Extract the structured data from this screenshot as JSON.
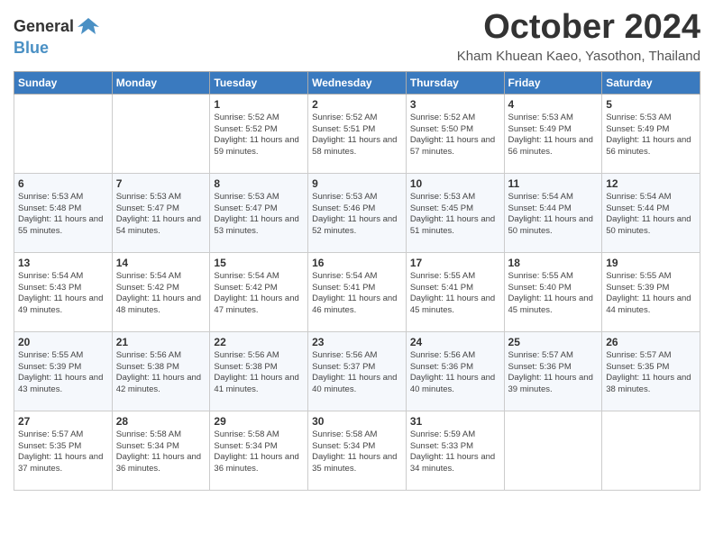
{
  "header": {
    "logo_line1": "General",
    "logo_line2": "Blue",
    "month_title": "October 2024",
    "location": "Kham Khuean Kaeo, Yasothon, Thailand"
  },
  "columns": [
    "Sunday",
    "Monday",
    "Tuesday",
    "Wednesday",
    "Thursday",
    "Friday",
    "Saturday"
  ],
  "weeks": [
    [
      {
        "day": "",
        "detail": ""
      },
      {
        "day": "",
        "detail": ""
      },
      {
        "day": "1",
        "detail": "Sunrise: 5:52 AM\nSunset: 5:52 PM\nDaylight: 11 hours and 59 minutes."
      },
      {
        "day": "2",
        "detail": "Sunrise: 5:52 AM\nSunset: 5:51 PM\nDaylight: 11 hours and 58 minutes."
      },
      {
        "day": "3",
        "detail": "Sunrise: 5:52 AM\nSunset: 5:50 PM\nDaylight: 11 hours and 57 minutes."
      },
      {
        "day": "4",
        "detail": "Sunrise: 5:53 AM\nSunset: 5:49 PM\nDaylight: 11 hours and 56 minutes."
      },
      {
        "day": "5",
        "detail": "Sunrise: 5:53 AM\nSunset: 5:49 PM\nDaylight: 11 hours and 56 minutes."
      }
    ],
    [
      {
        "day": "6",
        "detail": "Sunrise: 5:53 AM\nSunset: 5:48 PM\nDaylight: 11 hours and 55 minutes."
      },
      {
        "day": "7",
        "detail": "Sunrise: 5:53 AM\nSunset: 5:47 PM\nDaylight: 11 hours and 54 minutes."
      },
      {
        "day": "8",
        "detail": "Sunrise: 5:53 AM\nSunset: 5:47 PM\nDaylight: 11 hours and 53 minutes."
      },
      {
        "day": "9",
        "detail": "Sunrise: 5:53 AM\nSunset: 5:46 PM\nDaylight: 11 hours and 52 minutes."
      },
      {
        "day": "10",
        "detail": "Sunrise: 5:53 AM\nSunset: 5:45 PM\nDaylight: 11 hours and 51 minutes."
      },
      {
        "day": "11",
        "detail": "Sunrise: 5:54 AM\nSunset: 5:44 PM\nDaylight: 11 hours and 50 minutes."
      },
      {
        "day": "12",
        "detail": "Sunrise: 5:54 AM\nSunset: 5:44 PM\nDaylight: 11 hours and 50 minutes."
      }
    ],
    [
      {
        "day": "13",
        "detail": "Sunrise: 5:54 AM\nSunset: 5:43 PM\nDaylight: 11 hours and 49 minutes."
      },
      {
        "day": "14",
        "detail": "Sunrise: 5:54 AM\nSunset: 5:42 PM\nDaylight: 11 hours and 48 minutes."
      },
      {
        "day": "15",
        "detail": "Sunrise: 5:54 AM\nSunset: 5:42 PM\nDaylight: 11 hours and 47 minutes."
      },
      {
        "day": "16",
        "detail": "Sunrise: 5:54 AM\nSunset: 5:41 PM\nDaylight: 11 hours and 46 minutes."
      },
      {
        "day": "17",
        "detail": "Sunrise: 5:55 AM\nSunset: 5:41 PM\nDaylight: 11 hours and 45 minutes."
      },
      {
        "day": "18",
        "detail": "Sunrise: 5:55 AM\nSunset: 5:40 PM\nDaylight: 11 hours and 45 minutes."
      },
      {
        "day": "19",
        "detail": "Sunrise: 5:55 AM\nSunset: 5:39 PM\nDaylight: 11 hours and 44 minutes."
      }
    ],
    [
      {
        "day": "20",
        "detail": "Sunrise: 5:55 AM\nSunset: 5:39 PM\nDaylight: 11 hours and 43 minutes."
      },
      {
        "day": "21",
        "detail": "Sunrise: 5:56 AM\nSunset: 5:38 PM\nDaylight: 11 hours and 42 minutes."
      },
      {
        "day": "22",
        "detail": "Sunrise: 5:56 AM\nSunset: 5:38 PM\nDaylight: 11 hours and 41 minutes."
      },
      {
        "day": "23",
        "detail": "Sunrise: 5:56 AM\nSunset: 5:37 PM\nDaylight: 11 hours and 40 minutes."
      },
      {
        "day": "24",
        "detail": "Sunrise: 5:56 AM\nSunset: 5:36 PM\nDaylight: 11 hours and 40 minutes."
      },
      {
        "day": "25",
        "detail": "Sunrise: 5:57 AM\nSunset: 5:36 PM\nDaylight: 11 hours and 39 minutes."
      },
      {
        "day": "26",
        "detail": "Sunrise: 5:57 AM\nSunset: 5:35 PM\nDaylight: 11 hours and 38 minutes."
      }
    ],
    [
      {
        "day": "27",
        "detail": "Sunrise: 5:57 AM\nSunset: 5:35 PM\nDaylight: 11 hours and 37 minutes."
      },
      {
        "day": "28",
        "detail": "Sunrise: 5:58 AM\nSunset: 5:34 PM\nDaylight: 11 hours and 36 minutes."
      },
      {
        "day": "29",
        "detail": "Sunrise: 5:58 AM\nSunset: 5:34 PM\nDaylight: 11 hours and 36 minutes."
      },
      {
        "day": "30",
        "detail": "Sunrise: 5:58 AM\nSunset: 5:34 PM\nDaylight: 11 hours and 35 minutes."
      },
      {
        "day": "31",
        "detail": "Sunrise: 5:59 AM\nSunset: 5:33 PM\nDaylight: 11 hours and 34 minutes."
      },
      {
        "day": "",
        "detail": ""
      },
      {
        "day": "",
        "detail": ""
      }
    ]
  ]
}
